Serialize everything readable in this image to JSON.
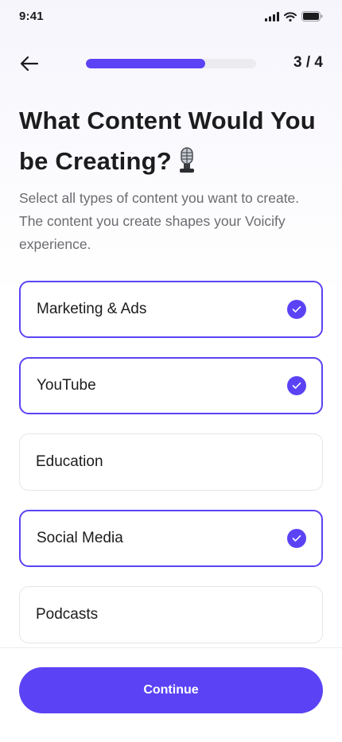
{
  "status_bar": {
    "time": "9:41",
    "icons": [
      "signal-icon",
      "wifi-icon",
      "battery-icon"
    ]
  },
  "header": {
    "back_icon": "arrow-left-icon",
    "progress_fraction": 0.7,
    "step": "3 / 4"
  },
  "title": {
    "text": "What Content Would You be Creating?",
    "icon": "microphone-icon"
  },
  "subtitle": "Select all types of content you want to create. The content you create shapes your Voicify experience.",
  "options": [
    {
      "label": "Marketing & Ads",
      "selected": true
    },
    {
      "label": "YouTube",
      "selected": true
    },
    {
      "label": "Education",
      "selected": false
    },
    {
      "label": "Social Media",
      "selected": true
    },
    {
      "label": "Podcasts",
      "selected": false
    }
  ],
  "footer": {
    "continue_label": "Continue"
  },
  "colors": {
    "accent": "#5b43f5",
    "track": "#ececf0",
    "text": "#1c1c1e",
    "muted": "#6b6b70"
  }
}
